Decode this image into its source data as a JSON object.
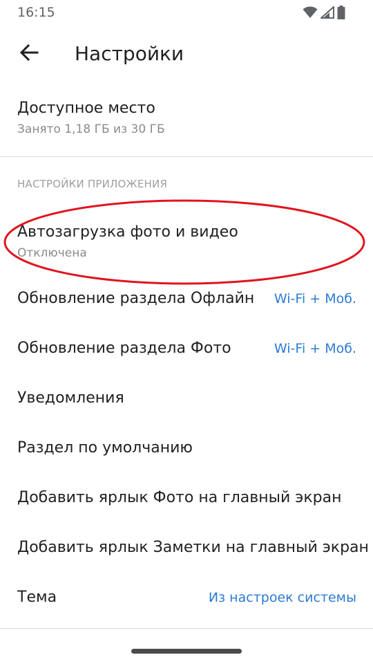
{
  "status_bar": {
    "time": "16:15",
    "icons": [
      "wifi-icon",
      "signal-icon",
      "battery-icon"
    ]
  },
  "header": {
    "back_icon": "arrow-back-icon",
    "title": "Настройки"
  },
  "storage": {
    "title": "Доступное место",
    "subtitle": "Занято 1,18 ГБ из 30 ГБ"
  },
  "app_settings": {
    "section_title": "НАСТРОЙКИ ПРИЛОЖЕНИЯ",
    "items": [
      {
        "title": "Автозагрузка фото и видео",
        "subtitle": "Отключена"
      },
      {
        "title": "Обновление раздела Офлайн",
        "value": "Wi-Fi + Моб."
      },
      {
        "title": "Обновление раздела Фото",
        "value": "Wi-Fi + Моб."
      },
      {
        "title": "Уведомления"
      },
      {
        "title": "Раздел по умолчанию"
      },
      {
        "title": "Добавить ярлык Фото на главный экран"
      },
      {
        "title": "Добавить ярлык Заметки на главный экран"
      },
      {
        "title": "Тема",
        "value": "Из настроек системы"
      }
    ]
  },
  "colors": {
    "accent_link": "#2b7bd1",
    "annotation_red": "#e0141e",
    "primary_text": "#212121",
    "secondary_text": "#8a8a8a"
  }
}
